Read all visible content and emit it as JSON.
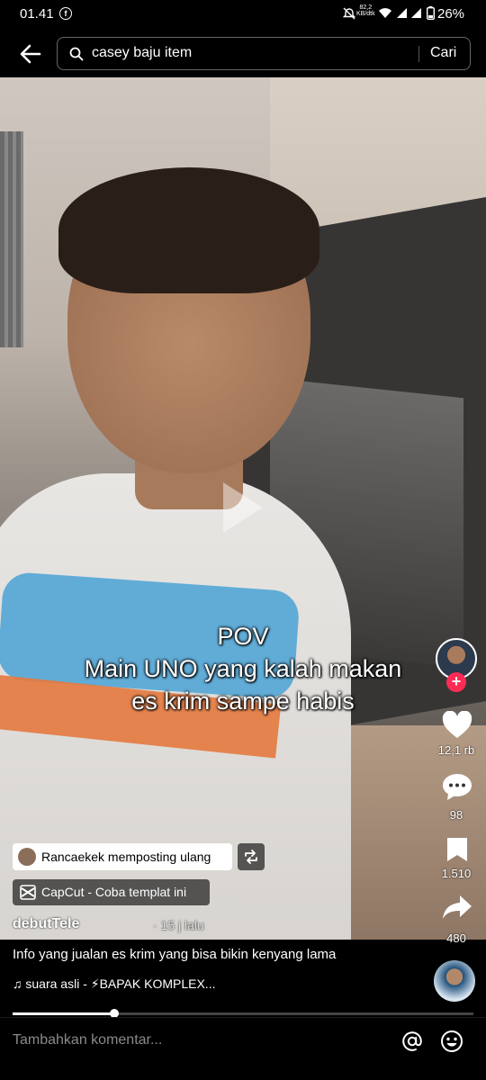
{
  "status_bar": {
    "time": "01.41",
    "notification_app": "f",
    "net_speed_value": "82,2",
    "net_speed_unit": "KB/dtk",
    "battery": "26%"
  },
  "search": {
    "query": "casey baju item",
    "submit_label": "Cari"
  },
  "video": {
    "caption_line1": "POV",
    "caption_line2": "Main UNO yang kalah makan",
    "caption_line3": "es krim sampe habis",
    "playback_progress": 0.22
  },
  "actions": {
    "likes": "12,1 rb",
    "comments": "98",
    "saves": "1.510",
    "shares": "480",
    "follow_symbol": "+"
  },
  "post": {
    "repost_text": "Rancaekek memposting ulang",
    "capcut_text": "CapCut - Coba templat ini",
    "username": "debutTele",
    "time_ago": "· 15 j lalu",
    "description": "Info yang jualan es krim yang bisa bikin kenyang lama",
    "sound": "♫ suara asli - ⚡BAPAK KOMPLEX..."
  },
  "comment_bar": {
    "placeholder": "Tambahkan komentar..."
  },
  "colors": {
    "accent": "#fe2c55",
    "background": "#000000"
  },
  "icons": [
    "back-arrow-icon",
    "search-icon",
    "heart-icon",
    "comment-icon",
    "bookmark-icon",
    "share-icon",
    "repost-icon",
    "capcut-icon",
    "mention-icon",
    "emoji-icon",
    "play-icon",
    "wifi-icon",
    "signal-icon",
    "battery-icon",
    "dnd-icon"
  ]
}
